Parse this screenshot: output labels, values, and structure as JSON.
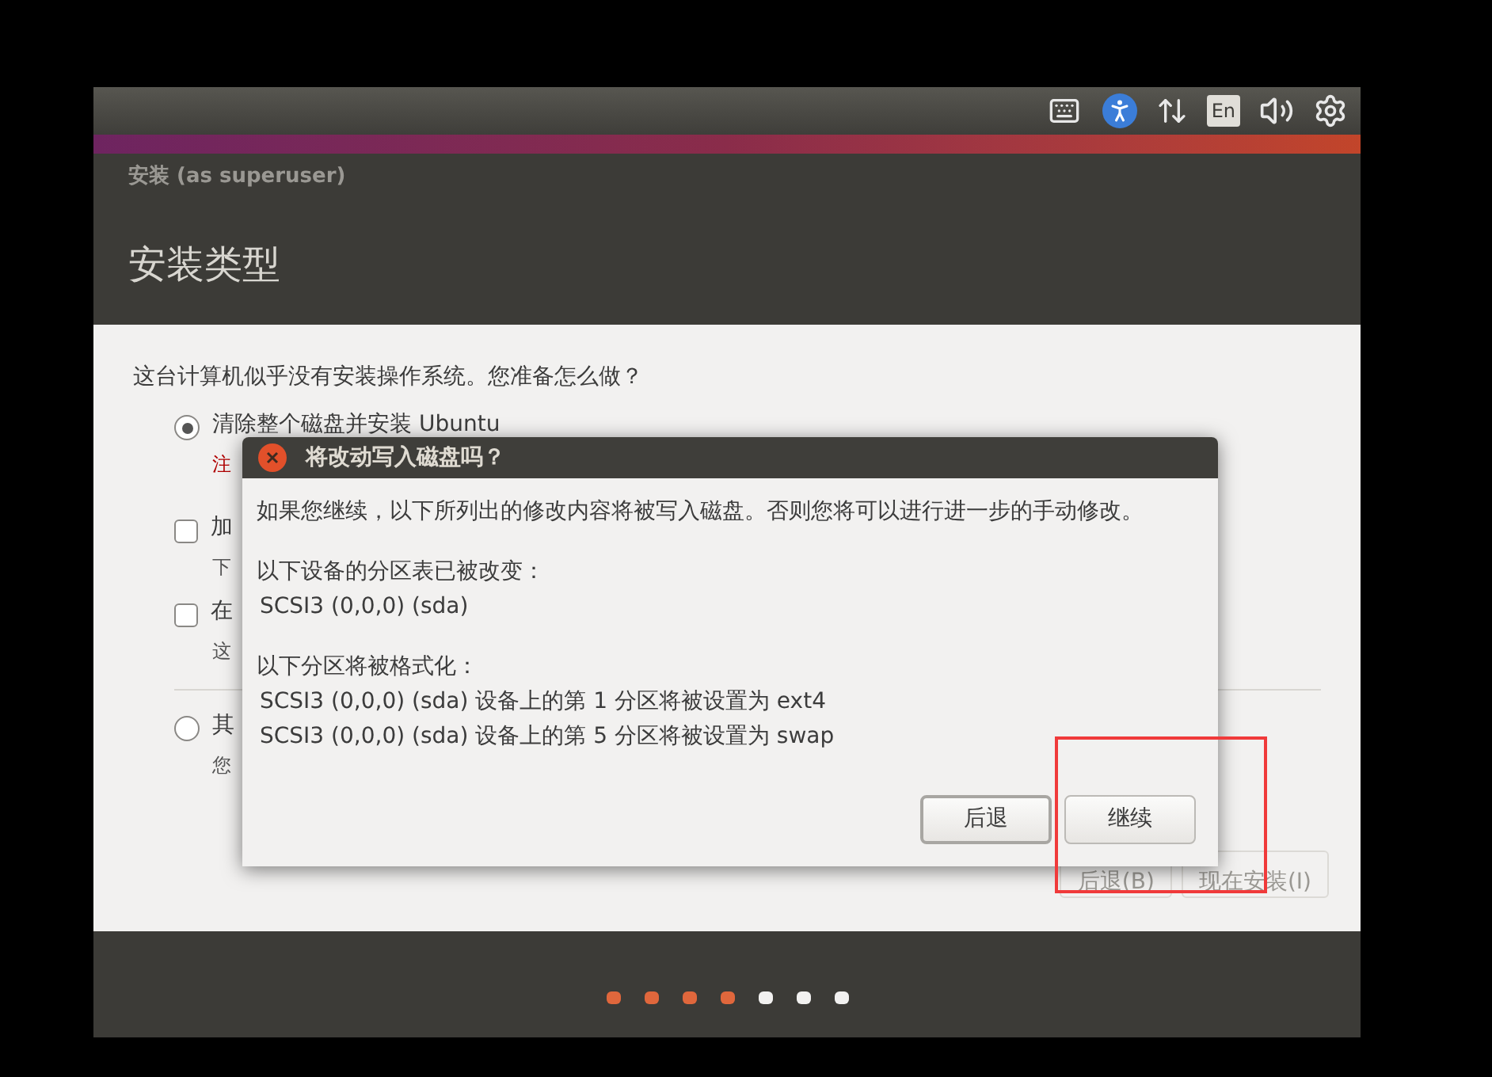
{
  "top_panel": {
    "language_indicator": "En"
  },
  "window": {
    "title": "安装 (as superuser)",
    "heading": "安装类型"
  },
  "question": "这台计算机似乎没有安装操作系统。您准备怎么做？",
  "options": [
    {
      "kind": "radio",
      "label": "清除整个磁盘并安装 Ubuntu",
      "note": "注",
      "warning": true,
      "selected": true
    },
    {
      "kind": "checkbox",
      "label": "加",
      "note": "下",
      "warning": false,
      "checked": false
    },
    {
      "kind": "checkbox",
      "label": "在",
      "note": "这",
      "warning": false,
      "checked": false
    },
    {
      "kind": "radio",
      "label": "其",
      "note": "您",
      "warning": false,
      "selected": false
    }
  ],
  "buttons": [
    "后退(B)",
    "现在安装(I)"
  ],
  "progress_dots": [
    {
      "done": true
    },
    {
      "done": true
    },
    {
      "done": true
    },
    {
      "done": true
    },
    {
      "done": false
    },
    {
      "done": false
    },
    {
      "done": false
    }
  ],
  "dialog": {
    "title": "将改动写入磁盘吗？",
    "intro": "如果您继续，以下所列出的修改内容将被写入磁盘。否则您将可以进行进一步的手动修改。",
    "sections": [
      {
        "heading": "以下设备的分区表已被改变：",
        "items": [
          "SCSI3 (0,0,0) (sda)"
        ]
      },
      {
        "heading": "以下分区将被格式化：",
        "items": [
          "SCSI3 (0,0,0) (sda) 设备上的第 1 分区将被设置为 ext4",
          "SCSI3 (0,0,0) (sda) 设备上的第 5 分区将被设置为 swap"
        ]
      }
    ],
    "buttons": [
      {
        "label": "后退",
        "default": true
      },
      {
        "label": "继续",
        "default": false
      }
    ]
  }
}
